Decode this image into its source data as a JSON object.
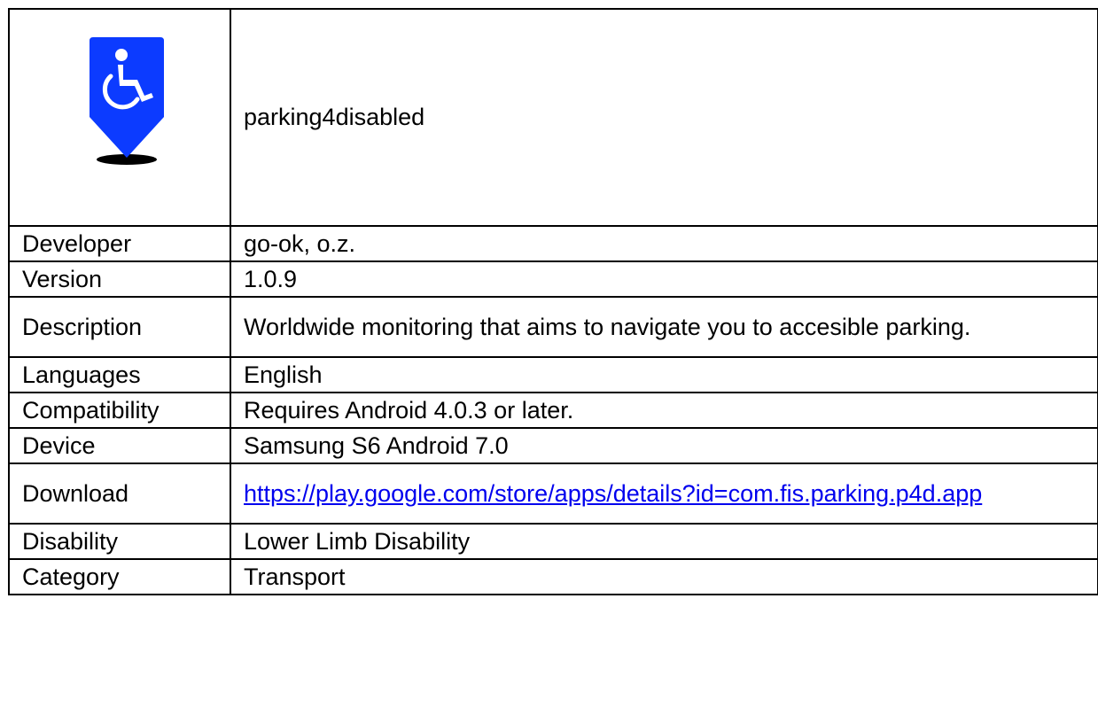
{
  "app": {
    "name": "parking4disabled",
    "icon": "wheelchair-parking-pin-icon",
    "icon_color": "#0c3bff"
  },
  "rows": [
    {
      "label": "Developer",
      "value": "go-ok, o.z."
    },
    {
      "label": "Version",
      "value": "1.0.9"
    },
    {
      "label": "Description",
      "value": "Worldwide monitoring that aims to navigate you to accesible parking."
    },
    {
      "label": "Languages",
      "value": "English"
    },
    {
      "label": "Compatibility",
      "value": "Requires Android 4.0.3 or later."
    },
    {
      "label": "Device",
      "value": "Samsung S6 Android 7.0"
    },
    {
      "label": "Download",
      "value": "https://play.google.com/store/apps/details?id=com.fis.parking.p4d.app"
    },
    {
      "label": "Disability",
      "value": "Lower Limb Disability"
    },
    {
      "label": "Category",
      "value": "Transport"
    }
  ],
  "colors": {
    "border": "#000000",
    "link": "#0000ee"
  }
}
